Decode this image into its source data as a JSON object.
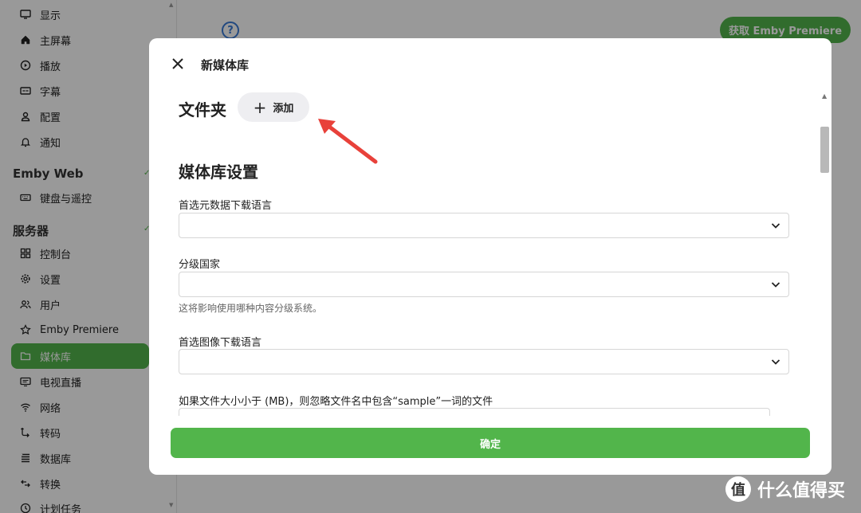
{
  "sidebar": {
    "items_top": [
      {
        "label": "显示",
        "icon": "monitor-icon"
      },
      {
        "label": "主屏幕",
        "icon": "home-icon"
      },
      {
        "label": "播放",
        "icon": "play-icon"
      },
      {
        "label": "字幕",
        "icon": "subtitles-icon"
      },
      {
        "label": "配置",
        "icon": "profile-icon"
      },
      {
        "label": "通知",
        "icon": "bell-icon"
      }
    ],
    "section_web": "Emby Web",
    "items_web": [
      {
        "label": "键盘与遥控",
        "icon": "keyboard-icon"
      }
    ],
    "section_server": "服务器",
    "items_server": [
      {
        "label": "控制台",
        "icon": "dashboard-icon"
      },
      {
        "label": "设置",
        "icon": "gear-icon"
      },
      {
        "label": "用户",
        "icon": "users-icon"
      },
      {
        "label": "Emby Premiere",
        "icon": "star-icon"
      },
      {
        "label": "媒体库",
        "icon": "folder-icon",
        "active": true
      },
      {
        "label": "电视直播",
        "icon": "tv-icon"
      },
      {
        "label": "网络",
        "icon": "wifi-icon"
      },
      {
        "label": "转码",
        "icon": "transcode-icon"
      },
      {
        "label": "数据库",
        "icon": "database-icon"
      },
      {
        "label": "转换",
        "icon": "convert-icon"
      },
      {
        "label": "计划任务",
        "icon": "clock-icon"
      }
    ]
  },
  "header": {
    "help_icon": "help-icon",
    "premiere_button": "获取 Emby Premiere"
  },
  "dialog": {
    "title": "新媒体库",
    "folders_heading": "文件夹",
    "add_button": "添加",
    "settings_heading": "媒体库设置",
    "fields": [
      {
        "label": "首选元数据下载语言",
        "value": ""
      },
      {
        "label": "分级国家",
        "value": "",
        "hint": "这将影响使用哪种内容分级系统。"
      },
      {
        "label": "首选图像下载语言",
        "value": ""
      },
      {
        "label": "如果文件大小小于 (MB)，则忽略文件名中包含“sample”一词的文件",
        "value": ""
      }
    ],
    "confirm_button": "确定"
  },
  "watermark": {
    "logo": "值",
    "text": "什么值得买"
  },
  "colors": {
    "accent": "#52b54b",
    "overlay": "#00000066",
    "annotation_arrow": "#e8413a"
  }
}
